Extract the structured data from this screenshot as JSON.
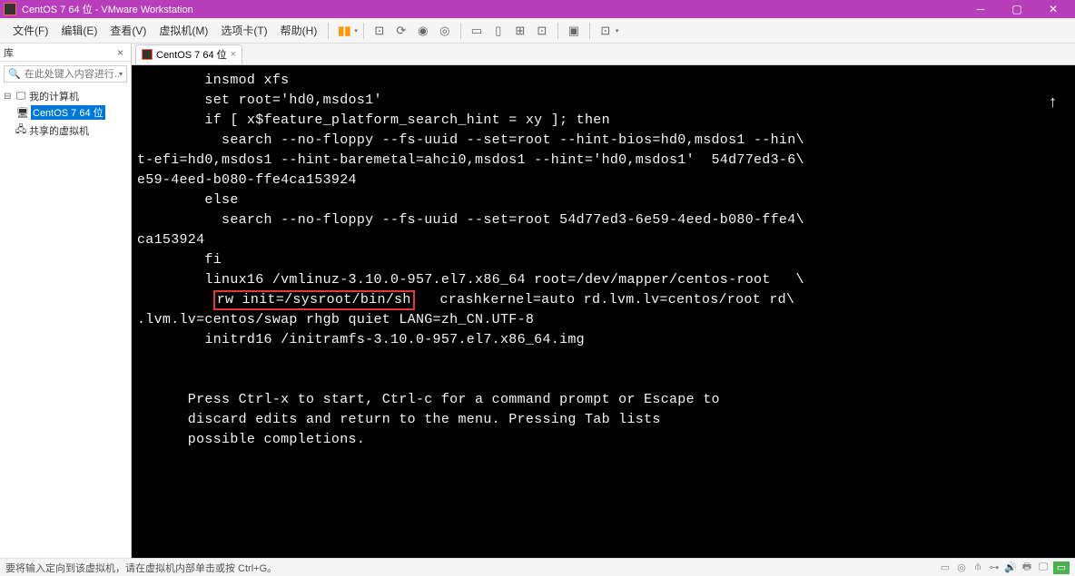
{
  "titlebar": {
    "title": "CentOS 7 64 位 - VMware Workstation"
  },
  "menu": {
    "file": "文件(F)",
    "edit": "编辑(E)",
    "view": "查看(V)",
    "vm": "虚拟机(M)",
    "tabs": "选项卡(T)",
    "help": "帮助(H)"
  },
  "sidebar": {
    "title": "库",
    "search_placeholder": "在此处键入内容进行...",
    "tree": {
      "root": "我的计算机",
      "item1": "CentOS 7 64 位",
      "item2": "共享的虚拟机"
    }
  },
  "tab": {
    "label": "CentOS 7 64 位"
  },
  "console": {
    "l1": "        insmod xfs",
    "l2": "        set root='hd0,msdos1'",
    "l3": "        if [ x$feature_platform_search_hint = xy ]; then",
    "l4": "          search --no-floppy --fs-uuid --set=root --hint-bios=hd0,msdos1 --hin\\",
    "l5": "t-efi=hd0,msdos1 --hint-baremetal=ahci0,msdos1 --hint='hd0,msdos1'  54d77ed3-6\\",
    "l6": "e59-4eed-b080-ffe4ca153924",
    "l7": "        else",
    "l8": "          search --no-floppy --fs-uuid --set=root 54d77ed3-6e59-4eed-b080-ffe4\\",
    "l9": "ca153924",
    "l10": "        fi",
    "l11": "        linux16 /vmlinuz-3.10.0-957.el7.x86_64 root=/dev/mapper/centos-root   \\",
    "l12a": "         ",
    "l12_hl": "rw init=/sysroot/bin/sh",
    "l12b": "   crashkernel=auto rd.lvm.lv=centos/root rd\\",
    "l13": ".lvm.lv=centos/swap rhgb quiet LANG=zh_CN.UTF-8",
    "l14": "        initrd16 /initramfs-3.10.0-957.el7.x86_64.img",
    "l15": "",
    "l16": "",
    "l17": "      Press Ctrl-x to start, Ctrl-c for a command prompt or Escape to",
    "l18": "      discard edits and return to the menu. Pressing Tab lists",
    "l19": "      possible completions."
  },
  "statusbar": {
    "text": "要将输入定向到该虚拟机，请在虚拟机内部单击或按 Ctrl+G。"
  }
}
